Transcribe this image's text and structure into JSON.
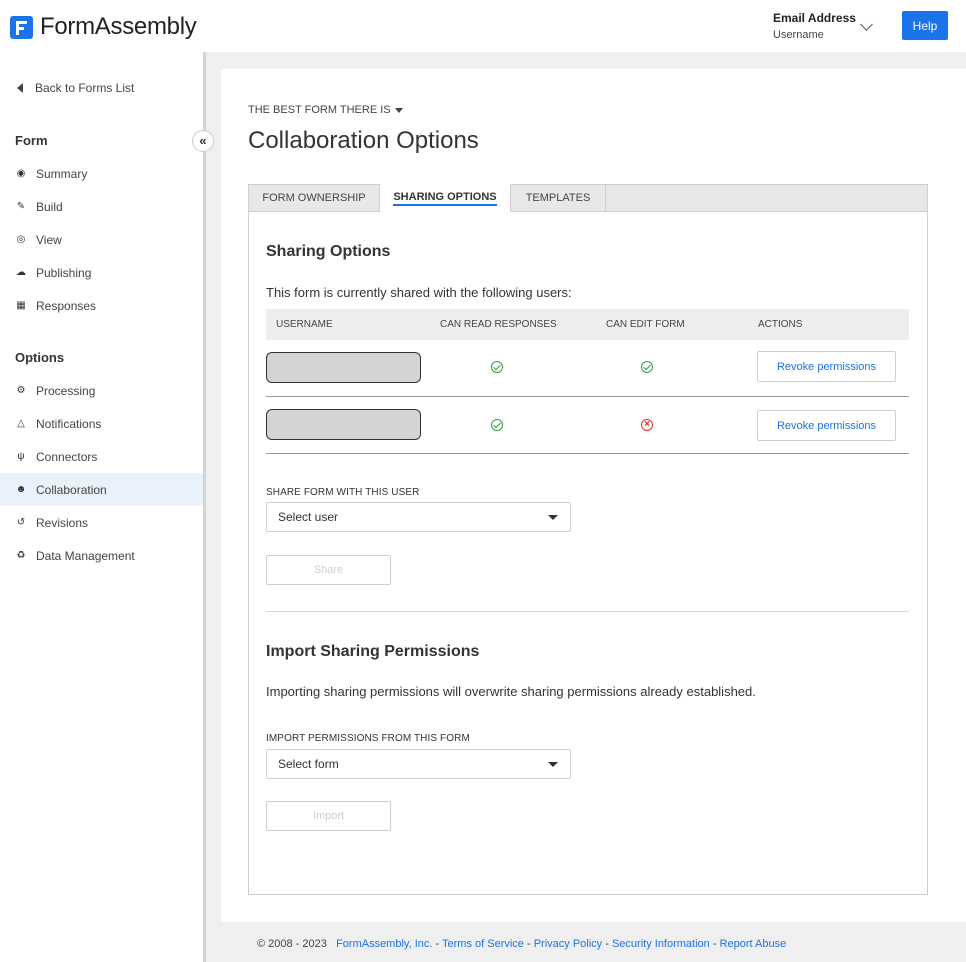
{
  "header": {
    "app_name": "FormAssembly",
    "account_email": "Email Address",
    "account_username": "Username",
    "help_label": "Help"
  },
  "sidebar": {
    "back_label": "Back to Forms List",
    "form_section": "Form",
    "collapse_glyph": "«",
    "form_items": [
      {
        "label": "Summary",
        "icon": "tachometer-icon"
      },
      {
        "label": "Build",
        "icon": "pencil-icon"
      },
      {
        "label": "View",
        "icon": "eye-icon"
      },
      {
        "label": "Publishing",
        "icon": "cloud-upload-icon"
      },
      {
        "label": "Responses",
        "icon": "table-icon"
      }
    ],
    "options_section": "Options",
    "option_items": [
      {
        "label": "Processing",
        "icon": "cogs-icon"
      },
      {
        "label": "Notifications",
        "icon": "bell-icon"
      },
      {
        "label": "Connectors",
        "icon": "plug-icon"
      },
      {
        "label": "Collaboration",
        "icon": "users-icon",
        "active": true
      },
      {
        "label": "Revisions",
        "icon": "history-icon"
      },
      {
        "label": "Data Management",
        "icon": "recycle-icon"
      }
    ]
  },
  "main": {
    "form_name": "THE BEST FORM THERE IS",
    "page_title": "Collaboration Options",
    "tabs": [
      {
        "label": "FORM OWNERSHIP"
      },
      {
        "label": "SHARING OPTIONS",
        "active": true
      },
      {
        "label": "TEMPLATES"
      }
    ],
    "sharing": {
      "heading": "Sharing Options",
      "intro": "This form is currently shared with the following users:",
      "columns": [
        "USERNAME",
        "CAN READ RESPONSES",
        "CAN EDIT FORM",
        "ACTIONS"
      ],
      "rows": [
        {
          "can_read": true,
          "can_edit": true,
          "action": "Revoke permissions"
        },
        {
          "can_read": true,
          "can_edit": false,
          "action": "Revoke permissions"
        }
      ],
      "share_label": "SHARE FORM WITH THIS USER",
      "share_select": "Select user",
      "share_button": "Share"
    },
    "import": {
      "heading": "Import Sharing Permissions",
      "description": "Importing sharing permissions will overwrite sharing permissions already established.",
      "label": "IMPORT PERMISSIONS FROM THIS FORM",
      "select": "Select form",
      "button": "Import"
    }
  },
  "footer": {
    "copyright": "© 2008 - 2023",
    "company": "FormAssembly, Inc.",
    "sep": " - ",
    "links": [
      "Terms of Service",
      "Privacy Policy",
      "Security Information",
      "Report Abuse"
    ]
  },
  "colors": {
    "accent": "#1a73e8",
    "ok": "#2e9e3e",
    "error": "#d93025"
  }
}
